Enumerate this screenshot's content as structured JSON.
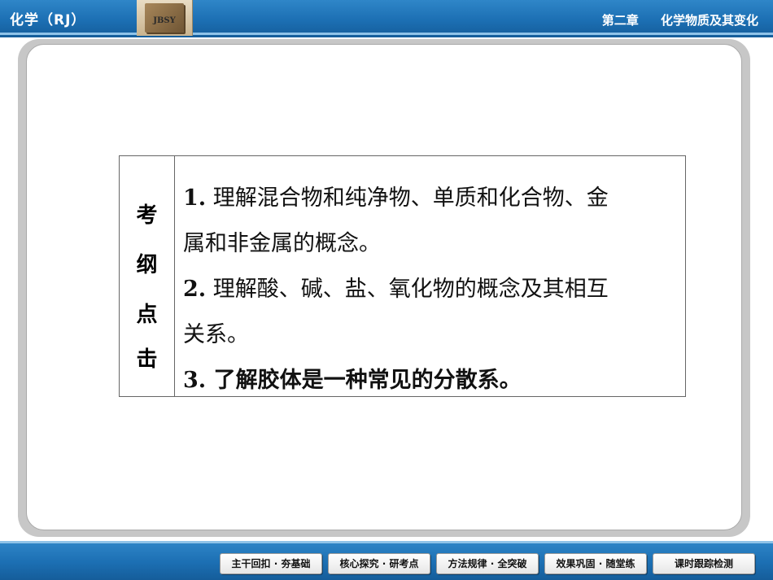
{
  "header": {
    "subject": "化学（RJ）",
    "logo_text": "JBSY",
    "chapter": "第二章",
    "chapter_title": "化学物质及其变化"
  },
  "content": {
    "label_chars": [
      "考",
      "纲",
      "点",
      "击"
    ],
    "item1_num": "1.",
    "item1_line1": "理解混合物和纯净物、单质和化合物、金",
    "item1_line2": "属和非金属的概念。",
    "item2_num": "2.",
    "item2_line1": "理解酸、碱、盐、氧化物的概念及其相互",
    "item2_line2": "关系。",
    "item3_num": "3.",
    "item3_line1": "了解胶体是一种常见的分散系。"
  },
  "nav": {
    "buttons": [
      "主干回扣 · 夯基础",
      "核心探究 · 研考点",
      "方法规律 · 全突破",
      "效果巩固 · 随堂练",
      "课时跟踪检测"
    ]
  },
  "colors": {
    "bar_blue": "#1c6fb3",
    "bar_highlight": "#8fc3e8",
    "frame_gray": "#c7c7c7"
  }
}
